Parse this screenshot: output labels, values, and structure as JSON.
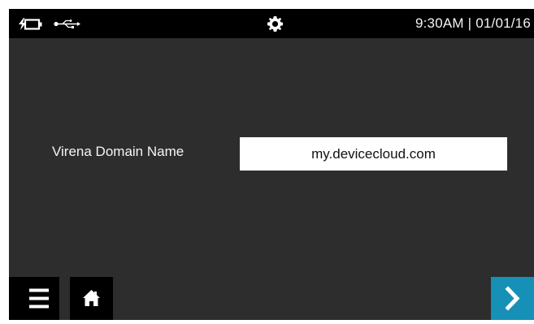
{
  "status_bar": {
    "icons": [
      "battery-charging-icon",
      "usb-icon",
      "gear-icon"
    ],
    "time": "9:30AM",
    "separator": "|",
    "date": "01/01/16",
    "clock_text": "9:30AM | 01/01/16"
  },
  "form": {
    "label": "Virena Domain Name",
    "domain_value": "my.devicecloud.com"
  },
  "nav": {
    "icons": [
      "menu-icon",
      "home-icon",
      "chevron-right-icon"
    ]
  },
  "colors": {
    "background": "#2d2d2d",
    "status_bar": "#000000",
    "nav_button": "#000000",
    "next_button": "#1790b7",
    "input_background": "#ffffff"
  }
}
